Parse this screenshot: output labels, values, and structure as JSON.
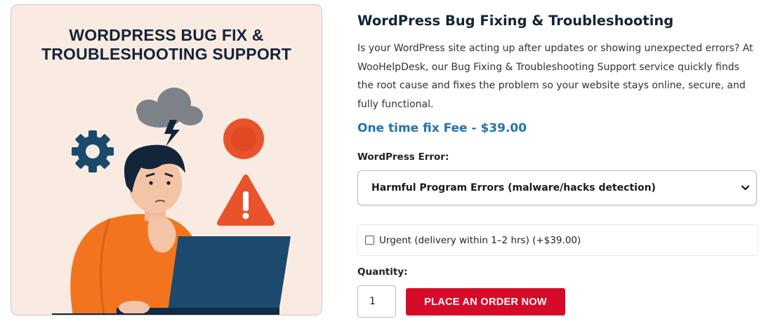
{
  "hero": {
    "title_line1": "WORDPRESS BUG FIX &",
    "title_line2": "TROUBLESHOOTING SUPPORT"
  },
  "product": {
    "title": "WordPress Bug Fixing & Troubleshooting",
    "description": "Is your WordPress site acting up after updates or showing unexpected errors? At WooHelpDesk, our Bug Fixing & Troubleshooting Support service quickly finds the root cause and fixes the problem so your website stays online, secure, and fully functional.",
    "price": "One time fix Fee - $39.00"
  },
  "error_select": {
    "label": "WordPress Error:",
    "selected": "Harmful Program Errors (malware/hacks detection)"
  },
  "urgent": {
    "label": "Urgent (delivery within 1–2 hrs) (+$39.00)",
    "checked": false
  },
  "quantity": {
    "label": "Quantity:",
    "value": "1"
  },
  "order_button": {
    "label": "PLACE AN ORDER NOW"
  },
  "colors": {
    "price_blue": "#1f74b4",
    "button_red": "#d60b2a",
    "title_navy": "#132536",
    "hero_bg": "#f9ebe1"
  }
}
